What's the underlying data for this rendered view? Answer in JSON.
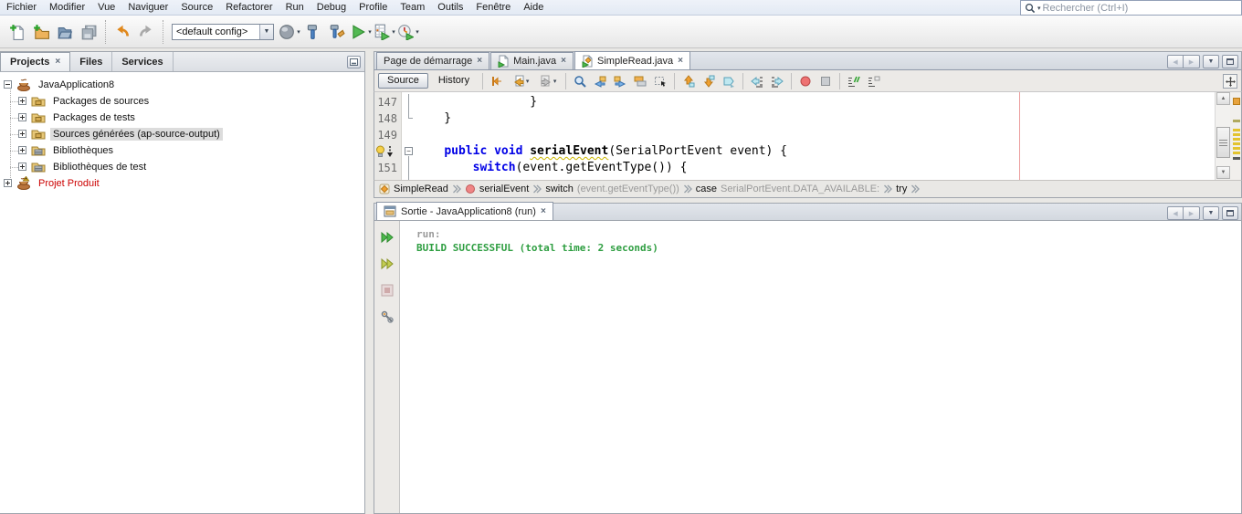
{
  "menu": {
    "items": [
      "Fichier",
      "Modifier",
      "Vue",
      "Naviguer",
      "Source",
      "Refactorer",
      "Run",
      "Debug",
      "Profile",
      "Team",
      "Outils",
      "Fenêtre",
      "Aide"
    ]
  },
  "search": {
    "placeholder": "Rechercher (Ctrl+I)",
    "icon": "search-icon"
  },
  "toolbar": {
    "config_combo": {
      "value": "<default config>"
    },
    "buttons": [
      "new-file",
      "new-project",
      "open-project",
      "save-all",
      "undo",
      "redo",
      "deploy",
      "build",
      "clean-and-build",
      "run",
      "debug",
      "profile"
    ]
  },
  "projects_panel": {
    "tabs": [
      {
        "label": "Projects",
        "active": true,
        "closable": true
      },
      {
        "label": "Files"
      },
      {
        "label": "Services"
      }
    ],
    "tree": [
      {
        "label": "JavaApplication8",
        "icon": "java-project",
        "state": "expanded"
      },
      {
        "label": "Packages de sources",
        "icon": "package-folder",
        "state": "collapsed"
      },
      {
        "label": "Packages de tests",
        "icon": "package-folder",
        "state": "collapsed"
      },
      {
        "label": "Sources générées (ap-source-output)",
        "icon": "package-folder",
        "state": "collapsed",
        "selected": true
      },
      {
        "label": "Bibliothèques",
        "icon": "libraries-folder",
        "state": "collapsed"
      },
      {
        "label": "Bibliothèques de test",
        "icon": "libraries-folder",
        "state": "collapsed"
      },
      {
        "label": "Projet Produit",
        "icon": "java-project-warning",
        "state": "collapsed",
        "error": true
      }
    ]
  },
  "editor": {
    "tabs": [
      {
        "label": "Page de démarrage"
      },
      {
        "label": "Main.java",
        "icon": "java-file"
      },
      {
        "label": "SimpleRead.java",
        "icon": "java-file-class",
        "active": true
      }
    ],
    "views": {
      "source": "Source",
      "history": "History"
    },
    "code": {
      "l147": {
        "num": "147",
        "text": "                }"
      },
      "l148": {
        "num": "148",
        "text": "    }"
      },
      "l149": {
        "num": "149",
        "text": ""
      },
      "l150": {
        "indent": "    ",
        "kw": "public void ",
        "name": "serialEvent",
        "rest": "(SerialPortEvent event) {"
      },
      "l151": {
        "num": "151",
        "indent": "        ",
        "kw": "switch",
        "rest": "(event.getEventType()) {"
      }
    },
    "breadcrumb": {
      "class_name": "SimpleRead",
      "method_name": "serialEvent",
      "switch_label": "switch",
      "switch_detail": " (event.getEventType())",
      "case_label": "case",
      "case_detail": " SerialPortEvent.DATA_AVAILABLE:",
      "try_label": "try"
    }
  },
  "output": {
    "tab_label": "Sortie - JavaApplication8 (run)",
    "run_line": "run:",
    "build_line": "BUILD SUCCESSFUL (total time: 2 seconds)"
  },
  "colors": {
    "keyword_blue": "#0000e6",
    "build_success_green": "#2e9e41",
    "project_error_red": "#cc0000",
    "margin_line_pink": "#eb9b9b",
    "tree_selection_gray": "#dcdcdc"
  }
}
